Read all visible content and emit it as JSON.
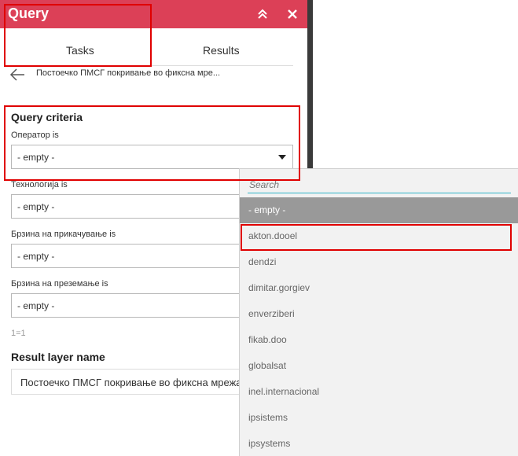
{
  "header": {
    "title": "Query",
    "collapse_icon": "double-chevron-up-icon",
    "close_icon": "close-icon",
    "color": "#dc4057"
  },
  "tabs": [
    {
      "label": "Tasks",
      "active": true
    },
    {
      "label": "Results",
      "active": false
    }
  ],
  "back": {
    "icon": "arrow-left-icon",
    "text": "Постоечко ПМСГ покривање во фиксна мре..."
  },
  "criteria": {
    "title": "Query criteria",
    "fields": [
      {
        "label": "Оператор is",
        "value": "- empty -"
      },
      {
        "label": "Технологија is",
        "value": "- empty -"
      },
      {
        "label": "Брзина на прикачување is",
        "value": "- empty -"
      },
      {
        "label": "Брзина на преземање is",
        "value": "- empty -"
      }
    ],
    "expression": "1=1"
  },
  "result_layer": {
    "title": "Result layer name",
    "value": "Постоечко ПМСГ покривање во фиксна мрежа"
  },
  "dropdown": {
    "search_placeholder": "Search",
    "options": [
      "- empty -",
      "akton.dooel",
      "dendzi",
      "dimitar.gorgiev",
      "enverziberi",
      "fikab.doo",
      "globalsat",
      "inel.internacional",
      "ipsistems",
      "ipsystems"
    ],
    "selected_index": 0
  }
}
